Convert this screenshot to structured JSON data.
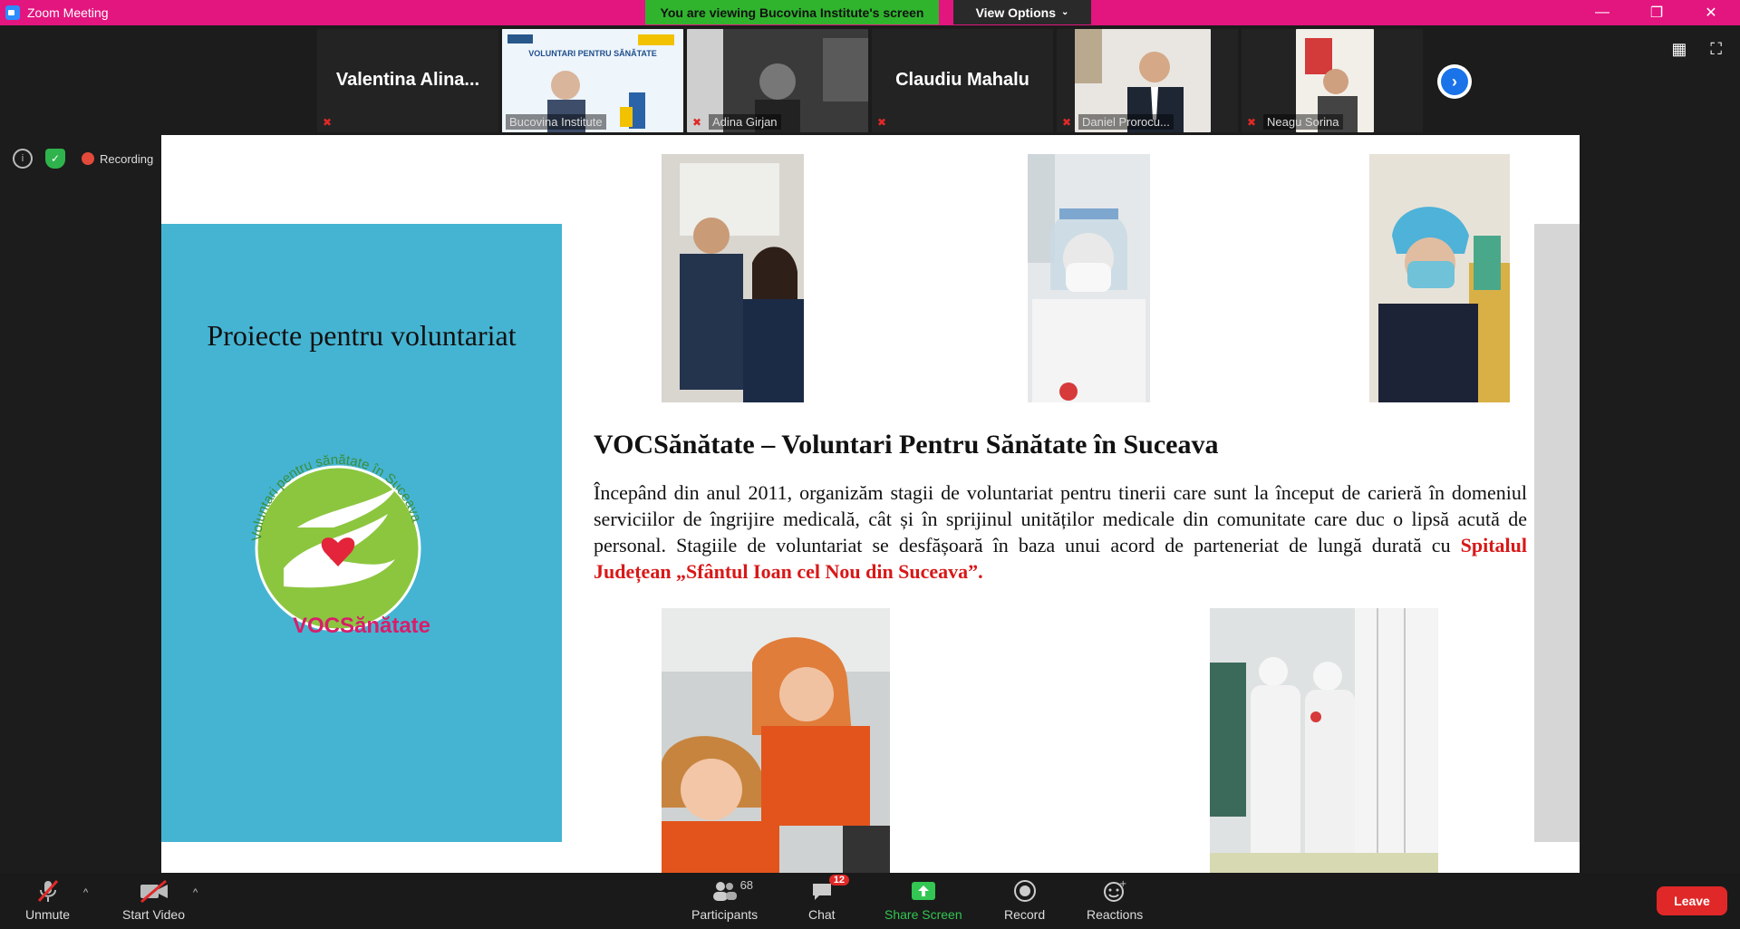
{
  "window": {
    "title": "Zoom Meeting",
    "banner": "You are viewing Bucovina Institute's screen",
    "view_options": "View Options"
  },
  "participants": [
    {
      "name": "Valentina  Alina..."
    },
    {
      "label": "Bucovina Institute",
      "thumb_title": "VOLUNTARI PENTRU SĂNĂTATE"
    },
    {
      "label": "Adina Girjan"
    },
    {
      "name": "Claudiu Mahalu"
    },
    {
      "label": "Daniel Prorocu..."
    },
    {
      "label": "Neagu Sorina"
    }
  ],
  "meeting_info": {
    "recording": "Recording"
  },
  "slide": {
    "panel_title": "Proiecte pentru voluntariat",
    "logo_arc_text": "Voluntari pentru sănătate în Suceava",
    "logo_name": "VOCSănătate",
    "heading": "VOCSănătate – Voluntari Pentru Sănătate în Suceava",
    "paragraph": "Începând din anul 2011, organizăm stagii de voluntariat pentru tinerii care sunt la început de carieră în domeniul serviciilor de îngrijire medicală, cât și în sprijinul unităților medicale din comunitate care duc o lipsă acută de personal. Stagiile de voluntariat se desfășoară în baza unui acord de parteneriat de lungă durată cu ",
    "paragraph_highlight": "Spitalul Județean „Sfântul Ioan cel  Nou din Suceava”."
  },
  "toolbar": {
    "unmute": "Unmute",
    "start_video": "Start Video",
    "participants": "Participants",
    "participants_count": "68",
    "chat": "Chat",
    "chat_badge": "12",
    "share_screen": "Share Screen",
    "record": "Record",
    "reactions": "Reactions",
    "leave": "Leave"
  },
  "colors": {
    "titlebar": "#e3157f",
    "banner": "#30b42e",
    "panel": "#45b4d3",
    "logo_pink": "#d81e6a",
    "highlight_red": "#d81818",
    "share_green": "#33c653",
    "leave_red": "#e02828"
  },
  "icons": [
    "zoom-icon",
    "chevron-down-icon",
    "minimize-icon",
    "restore-icon",
    "close-icon",
    "muted-mic-icon",
    "chevron-right-icon",
    "gallery-view-icon",
    "fullscreen-icon",
    "info-icon",
    "shield-icon",
    "record-dot-icon",
    "video-off-icon",
    "participants-icon",
    "chat-icon",
    "share-screen-icon",
    "record-icon",
    "reactions-icon"
  ]
}
